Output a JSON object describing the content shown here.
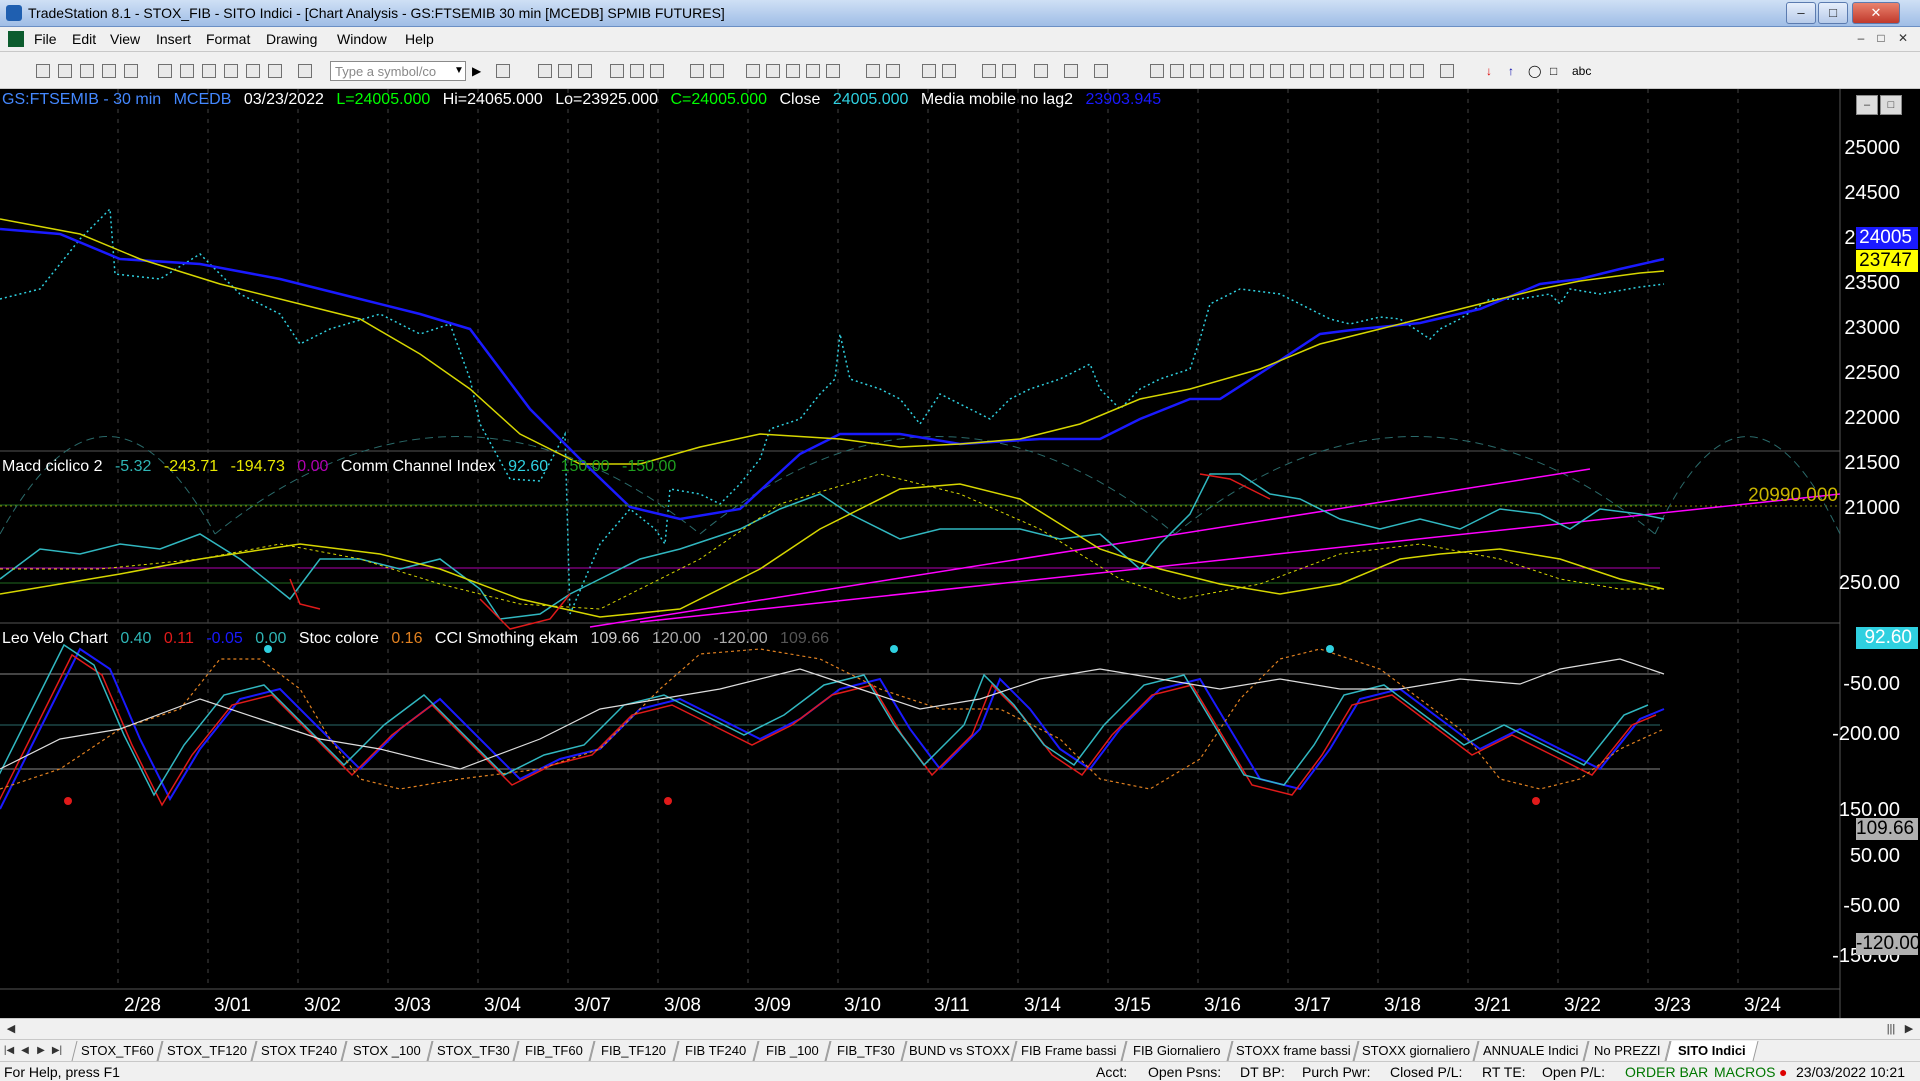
{
  "window": {
    "title": "TradeStation 8.1 - STOX_FIB - SITO Indici - [Chart Analysis - GS:FTSEMIB  30 min  [MCEDB] SPMIB FUTURES]"
  },
  "menu": [
    "File",
    "Edit",
    "View",
    "Insert",
    "Format",
    "Drawing",
    "Window",
    "Help"
  ],
  "toolbar": {
    "symbol_placeholder": "Type a symbol/co",
    "abc_label": "abc"
  },
  "price_legend": {
    "symbol": "GS:FTSEMIB - 30 min",
    "exchange": "MCEDB",
    "date": "03/23/2022",
    "low_first": "L=24005.000",
    "high": "Hi=24065.000",
    "low": "Lo=23925.000",
    "close_eq": "C=24005.000",
    "close_label": "Close",
    "close_value": "24005.000",
    "ma_label": "Media mobile no lag2",
    "ma_value": "23903.945"
  },
  "macd_legend": {
    "name": "Macd ciclico 2",
    "v1": "-5.32",
    "v2": "-243.71",
    "v3": "-194.73",
    "v4": "0.00",
    "cci_name": "Comm Channel Index",
    "c1": "92.60",
    "c2": "150.00",
    "c3": "-150.00"
  },
  "leo_legend": {
    "name": "Leo Velo Chart",
    "v1": "0.40",
    "v2": "0.11",
    "v3": "-0.05",
    "v4": "0.00",
    "stoc_name": "Stoc colore",
    "s1": "0.16",
    "cci_name": "CCI Smothing ekam",
    "c1": "109.66",
    "c2": "120.00",
    "c3": "-120.00",
    "c4": "109.66"
  },
  "price_axis": [
    "25000",
    "24500",
    "24000",
    "23500",
    "23000",
    "22500",
    "22000",
    "21500",
    "21000"
  ],
  "price_tags": {
    "last": "24005",
    "ma": "23747",
    "level": "20990.000"
  },
  "cci_axis": [
    "250.00",
    "-50.00",
    "-200.00"
  ],
  "cci_tag": "92.60",
  "leo_axis": [
    "150.00",
    "50.00",
    "-50.00",
    "-150.00"
  ],
  "leo_tags": {
    "top": "109.66",
    "bottom": "-120.00"
  },
  "dates": [
    "2/28",
    "3/01",
    "3/02",
    "3/03",
    "3/04",
    "3/07",
    "3/08",
    "3/09",
    "3/10",
    "3/11",
    "3/14",
    "3/15",
    "3/16",
    "3/17",
    "3/18",
    "3/21",
    "3/22",
    "3/23",
    "3/24"
  ],
  "sheet_tabs": [
    "STOX_TF60",
    "STOX_TF120",
    "STOX TF240",
    "STOX _100",
    "STOX_TF30",
    "FIB_TF60",
    "FIB_TF120",
    "FIB TF240",
    "FIB _100",
    "FIB_TF30",
    "BUND vs STOXX",
    "FIB Frame bassi",
    "FIB Giornaliero",
    "STOXX frame bassi",
    "STOXX giornaliero",
    "ANNUALE Indici",
    "No PREZZI",
    "SITO Indici"
  ],
  "status": {
    "help": "For Help, press F1",
    "acct": "Acct:",
    "open_psns": "Open Psns:",
    "dt_bp": "DT BP:",
    "purch_pwr": "Purch Pwr:",
    "closed_pl": "Closed P/L:",
    "rt_te": "RT TE:",
    "open_pl": "Open P/L:",
    "order_bar": "ORDER BAR",
    "macros": "MACROS",
    "datetime": "23/03/2022 10:21"
  },
  "colors": {
    "price_dots": "#2fd0e0",
    "ma_blue": "#1a1aff",
    "ma_yellow": "#d6d600",
    "cci": "#31b7c0",
    "magenta": "#ff00ff",
    "red": "#e01a1a"
  }
}
